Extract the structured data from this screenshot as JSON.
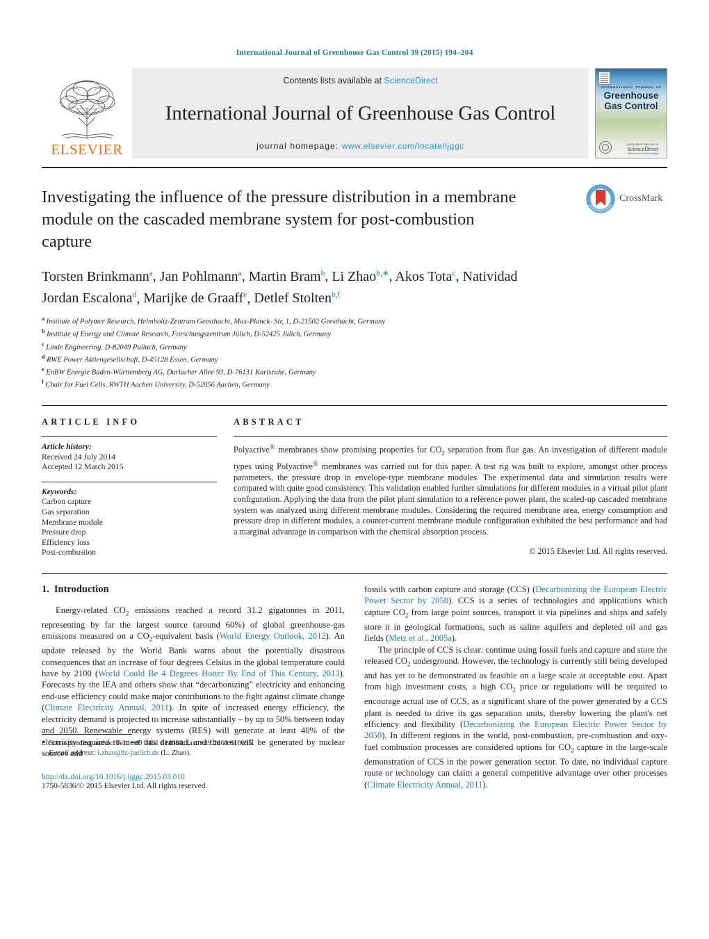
{
  "running_head": "International Journal of Greenhouse Gas Control 39 (2015) 194–204",
  "masthead": {
    "publisher_name": "ELSEVIER",
    "contents_prefix": "Contents lists available at ",
    "contents_link": "ScienceDirect",
    "journal_title": "International Journal of Greenhouse Gas Control",
    "homepage_prefix": "journal homepage: ",
    "homepage_url": "www.elsevier.com/locate/ijggc",
    "cover": {
      "kicker": "INTERNATIONAL JOURNAL OF",
      "line1": "Greenhouse",
      "line2": "Gas Control",
      "pub_small": "AVAILABLE ONLINE AT",
      "pub_name": "ScienceDirect",
      "pub_url": "www.elsevier.com/locate/ijggc"
    }
  },
  "article": {
    "title": "Investigating the influence of the pressure distribution in a membrane module on the cascaded membrane system for post-combustion capture",
    "crossmark_label": "CrossMark",
    "authors": [
      {
        "name": "Torsten Brinkmann",
        "sup": "a",
        "sep": ", "
      },
      {
        "name": "Jan Pohlmann",
        "sup": "a",
        "sep": ", "
      },
      {
        "name": "Martin Bram",
        "sup": "b",
        "sep": ", "
      },
      {
        "name": "Li Zhao",
        "sup": "b,∗",
        "sep": ", "
      },
      {
        "name": "Akos Tota",
        "sup": "c",
        "sep": ", "
      },
      {
        "name": "Natividad Jordan Escalona",
        "sup": "d",
        "sep": ", "
      },
      {
        "name": "Marijke de Graaff",
        "sup": "e",
        "sep": ", "
      },
      {
        "name": "Detlef Stolten",
        "sup": "b,f",
        "sep": ""
      }
    ],
    "affiliations": [
      {
        "label": "a",
        "text": "Institute of Polymer Research, Helmholtz-Zentrum Geesthacht, Max-Planck- Str, 1, D-21502 Geesthacht, Germany"
      },
      {
        "label": "b",
        "text": "Institute of Energy and Climate Research, Forschungszentrum Jülich, D-52425 Jülich, Germany"
      },
      {
        "label": "c",
        "text": "Linde Engineering, D-82049 Pullach, Germany"
      },
      {
        "label": "d",
        "text": "RWE Power Aktiengesellschaft, D-45128 Essen, Germany"
      },
      {
        "label": "e",
        "text": "EnBW Energie Baden-Württemberg AG, Durlacher Allee 93, D-76131 Karlsruhe, Germany"
      },
      {
        "label": "f",
        "text": "Chair for Fuel Cells, RWTH Aachen University, D-52056 Aachen, Germany"
      }
    ]
  },
  "article_info": {
    "heading": "ARTICLE INFO",
    "history_label": "Article history:",
    "history": [
      "Received 24 July 2014",
      "Accepted 12 March 2015"
    ],
    "keywords_label": "Keywords:",
    "keywords": [
      "Carbon capture",
      "Gas separation",
      "Membrane module",
      "Pressure drop",
      "Efficiency loss",
      "Post-combustion"
    ]
  },
  "abstract": {
    "heading": "ABSTRACT",
    "text": "Polyactive® membranes show promising properties for CO2 separation from flue gas. An investigation of different module types using Polyactive® membranes was carried out for this paper. A test rig was built to explore, amongst other process parameters, the pressure drop in envelope-type membrane modules. The experimental data and simulation results were compared with quite good consistency. This validation enabled further simulations for different modules in a virtual pilot plant configuration. Applying the data from the pilot plant simulation to a reference power plant, the scaled-up cascaded membrane system was analyzed using different membrane modules. Considering the required membrane area, energy consumption and pressure drop in different modules, a counter-current membrane module configuration exhibited the best performance and had a marginal advantage in comparison with the chemical absorption process.",
    "copyright": "© 2015 Elsevier Ltd. All rights reserved."
  },
  "introduction": {
    "heading_number": "1.",
    "heading_text": "Introduction",
    "left_paragraph_1": "Energy-related CO2 emissions reached a record 31.2 gigatonnes in 2011, representing by far the largest source (around 60%) of global greenhouse-gas emissions measured on a CO2-equivalent basis (World Energy Outlook, 2012). An update released by the World Bank warns about the potentially disastrous consequences that an increase of four degrees Celsius in the global temperature could have by 2100 (World Could Be 4 Degrees Hotter By End of This Century, 2013). Forecasts by the IEA and others show that \"decarbonizing\" electricity and enhancing end-use efficiency could make major contributions to the fight against climate change (Climate Electricity Annual, 2011). In spite of increased energy efficiency, the electricity demand is projected to increase substantially – by up to 50% between today and 2050. Renewable energy systems (RES) will generate at least 40% of the electricity required to meet this demand, and the rest will be generated by nuclear sources and",
    "right_paragraph_1": "fossils with carbon capture and storage (CCS) (Decarbonizing the European Electric Power Sector by 2050). CCS is a series of technologies and applications which capture CO2 from large point sources, transport it via pipelines and ships and safely store it in geological formations, such as saline aquifers and depleted oil and gas fields (Metz et al., 2005a).",
    "right_paragraph_2": "The principle of CCS is clear: continue using fossil fuels and capture and store the released CO2 underground. However, the technology is currently still being developed and has yet to be demonstrated as feasible on a large scale at acceptable cost. Apart from high investment costs, a high CO2 price or regulations will be required to encourage actual use of CCS, as a significant share of the power generated by a CCS plant is needed to drive its gas separation units, thereby lowering the plant's net efficiency and flexibility (Decarbonizing the European Electric Power Sector by 2050). In different regions in the world, post-combustion, pre-combustion and oxy-fuel combustion processes are considered options for CO2 capture in the large-scale demonstration of CCS in the power generation sector. To date, no individual capture route or technology can claim a general competitive advantage over other processes (Climate Electricity Annual, 2011)."
  },
  "footer": {
    "corresponding_star": "*",
    "corresponding_text": "Corresponding author. Tel.: +49 2461 614064; fax: +49 2461 616695.",
    "email_label": "E-mail address:",
    "email": "l.zhao@fz-juelich.de",
    "email_suffix": "(L. Zhao).",
    "doi": "http://dx.doi.org/10.1016/j.ijggc.2015.03.010",
    "issn": "1750-5836/© 2015 Elsevier Ltd. All rights reserved."
  },
  "colors": {
    "link": "#1a7fa8",
    "science_direct": "#1a9ad1",
    "elsevier_orange": "#E9711C",
    "masthead_bg": "#ececec",
    "text": "#231f20"
  }
}
